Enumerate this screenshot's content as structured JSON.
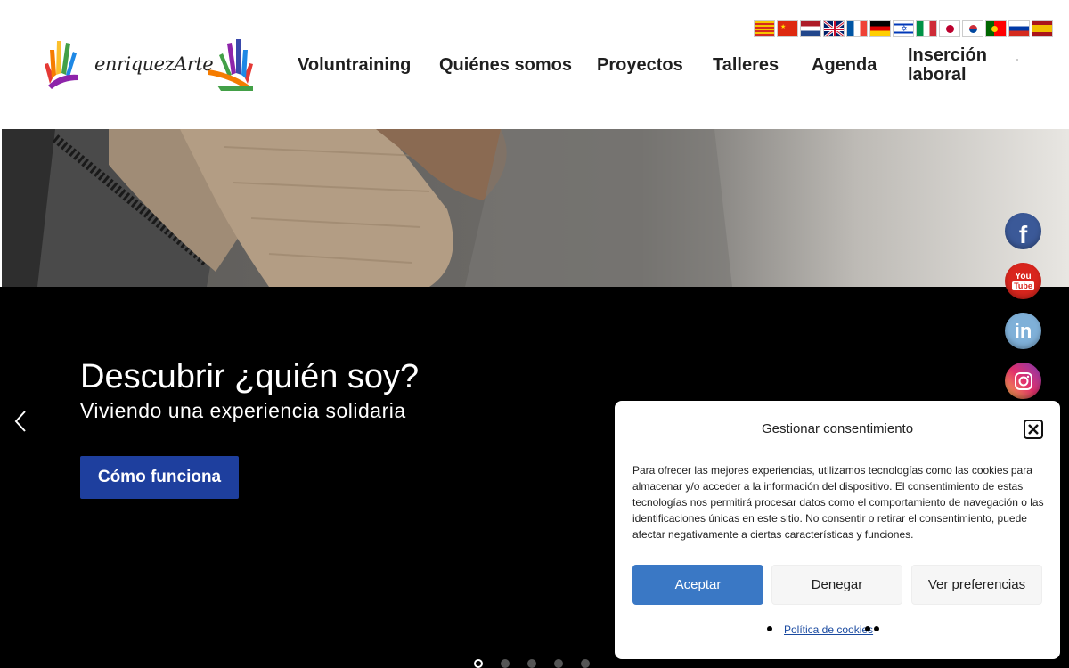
{
  "header": {
    "logo_text": "enriquezArte",
    "nav": [
      {
        "label": "Voluntraining"
      },
      {
        "label": "Quiénes somos"
      },
      {
        "label": "Proyectos"
      },
      {
        "label": "Talleres"
      },
      {
        "label": "Agenda"
      },
      {
        "label_line1": "Inserción",
        "label_line2": "laboral"
      }
    ],
    "languages": [
      "catalan-flag-icon",
      "china-flag-icon",
      "netherlands-flag-icon",
      "uk-flag-icon",
      "france-flag-icon",
      "germany-flag-icon",
      "israel-flag-icon",
      "italy-flag-icon",
      "japan-flag-icon",
      "korea-flag-icon",
      "portugal-flag-icon",
      "russia-flag-icon",
      "spain-flag-icon"
    ]
  },
  "hero": {
    "title": "Descubrir ¿quién soy?",
    "subtitle": "Viviendo una experiencia solidaria",
    "button": "Cómo funciona",
    "slides_count": 5,
    "active_slide": 1
  },
  "social": {
    "facebook": {
      "icon": "facebook-icon",
      "color": "#3b5998"
    },
    "youtube": {
      "icon": "youtube-icon",
      "color": "#d9251d",
      "label_top": "You",
      "label_bottom": "Tube"
    },
    "linkedin": {
      "icon": "linkedin-icon",
      "color": "#7fb0d8",
      "label": "in"
    },
    "instagram": {
      "icon": "instagram-icon",
      "color": "#e1306c"
    }
  },
  "cookie_modal": {
    "title": "Gestionar consentimiento",
    "body": "Para ofrecer las mejores experiencias, utilizamos tecnologías como las cookies para almacenar y/o acceder a la información del dispositivo. El consentimiento de estas tecnologías nos permitirá procesar datos como el comportamiento de navegación o las identificaciones únicas en este sitio. No consentir o retirar el consentimiento, puede afectar negativamente a ciertas características y funciones.",
    "accept": "Aceptar",
    "deny": "Denegar",
    "preferences": "Ver preferencias",
    "policy_link": "Política de cookies"
  },
  "colors": {
    "button_blue": "#1e3f9e",
    "accept_blue": "#3a78c5",
    "hero_bg": "#000000"
  }
}
